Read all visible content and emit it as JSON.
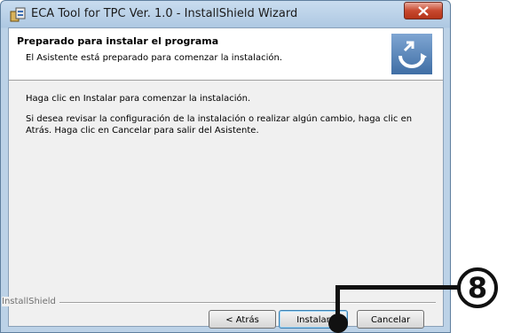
{
  "window": {
    "title": "ECA Tool for TPC Ver. 1.0 - InstallShield Wizard",
    "close_label": "Close"
  },
  "header": {
    "title": "Preparado para instalar el programa",
    "subtitle": "El Asistente está preparado para comenzar la instalación.",
    "graphic_icon": "installshield-logo-icon"
  },
  "body": {
    "line1": "Haga clic en Instalar para comenzar la instalación.",
    "line2": "Si desea revisar la configuración de la instalación o realizar algún cambio, haga clic en Atrás. Haga clic en Cancelar para salir del Asistente."
  },
  "footer": {
    "brand": "InstallShield",
    "back_label": "< Atrás",
    "install_label": "Instalar",
    "cancel_label": "Cancelar"
  },
  "callout": {
    "number": "8"
  },
  "colors": {
    "title_bar": "#b9d1ea",
    "close_button": "#c8492f",
    "header_graphic": "#5b86b6"
  }
}
